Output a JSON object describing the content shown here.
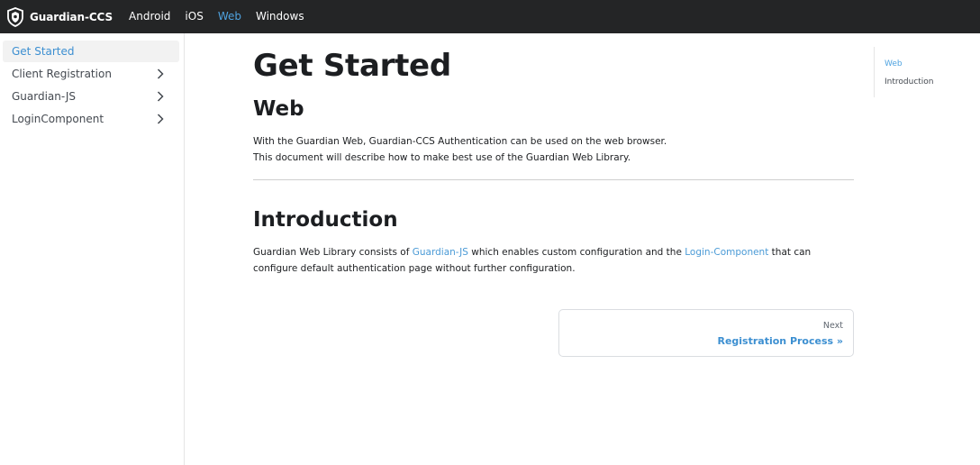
{
  "nav": {
    "brand_title": "Guardian-CCS",
    "links": [
      {
        "label": "Android",
        "active": false
      },
      {
        "label": "iOS",
        "active": false
      },
      {
        "label": "Web",
        "active": true
      },
      {
        "label": "Windows",
        "active": false
      }
    ]
  },
  "sidebar": {
    "items": [
      {
        "label": "Get Started",
        "active": true,
        "expandable": false
      },
      {
        "label": "Client Registration",
        "active": false,
        "expandable": true
      },
      {
        "label": "Guardian-JS",
        "active": false,
        "expandable": true
      },
      {
        "label": "LoginComponent",
        "active": false,
        "expandable": true
      }
    ]
  },
  "main": {
    "title": "Get Started",
    "web_heading": "Web",
    "web_para_1": "With the Guardian Web, Guardian-CCS Authentication can be used on the web browser.",
    "web_para_2": "This document will describe how to make best use of the Guardian Web Library.",
    "intro_heading": "Introduction",
    "intro_text_1": "Guardian Web Library consists of ",
    "intro_link_1": "Guardian-JS",
    "intro_text_2": " which enables custom configuration and the ",
    "intro_link_2": "Login-Component",
    "intro_text_3": " that can configure default authentication page without further configuration."
  },
  "pager": {
    "sub_label": "Next",
    "title": "Registration Process »"
  },
  "toc": {
    "items": [
      {
        "label": "Web",
        "active": true
      },
      {
        "label": "Introduction",
        "active": false
      }
    ]
  },
  "colors": {
    "nav_bg": "#242526",
    "accent": "#4fa3e0",
    "link": "#4a9ad6"
  },
  "icons": {
    "brand": "shield-logo-icon",
    "sidebar_expand": "chevron-right-icon"
  }
}
